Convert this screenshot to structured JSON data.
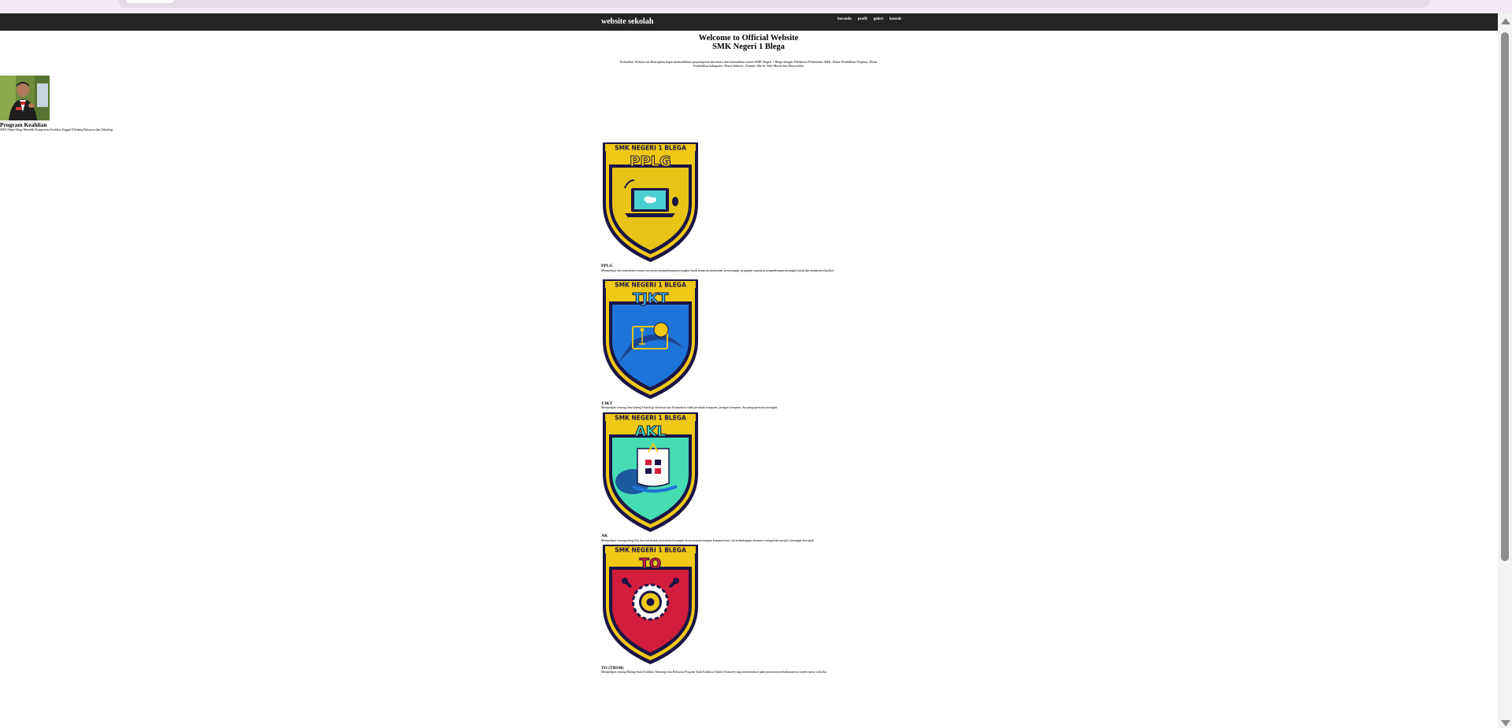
{
  "navbar": {
    "brand": "website sekolah",
    "menu": [
      "beranda",
      "profil",
      "galeri",
      "kontak"
    ]
  },
  "hero": {
    "title_line1": "Welcome to Official Website",
    "title_line2": "SMK Negeri 1 Blega",
    "description": "Kehadiran Website ini diharapkan dapat memudahkan penyampaian informasi dan komunikasi antara SMK Negeri 1 Blega dengan Direktorat Pembinaan SMK, Dinas Pendidikan Propinsi, Dinas Pendidikan kabupaten, Dunia Industri, Alumni, Murid, Wali Murid dan Masyarakat"
  },
  "sidebar": {
    "title": "Program Keahlian",
    "description": "SMK Negeri blega Memiliki Kompetensi Keahlian Unggul Dibidang Rekayasa dan Teknologi"
  },
  "programs": [
    {
      "badge_school": "SMK NEGERI 1 BLEGA",
      "badge_code": "PPLG",
      "name": "PPLG",
      "description": "Mempelajari dan memahami semua cara-proses pengembangan perangkat lunak termasuk pembuatan, perancangan, pengujian organisasi pengembangan perangkat lunak dan manajemen kualitas",
      "colors": {
        "body": "#e8c417",
        "edge": "#f0c816",
        "dark": "#1a1446"
      }
    },
    {
      "badge_school": "SMK NEGERI 1 BLEGA",
      "badge_code": "TJKT",
      "name": "TJKT",
      "description": "Mempelajari tentang ilmu bidang Teknologi informasi dan Komunikasi tiduk perakitan komputer, jaringan komputer, dan pengoperasian perangkat",
      "colors": {
        "body": "#1e74d8",
        "edge": "#f0c816",
        "dark": "#1a1446"
      }
    },
    {
      "badge_school": "SMK NEGERI 1 BLEGA",
      "badge_code": "AKL",
      "name": "AK",
      "description": "Mempelajari tentang mengelola dan melakukan pencatatan keuangan secara manual maupun komputerisasi, etis kelembagaan akuntansi, mengelola transaksi keuangan dan pajak",
      "colors": {
        "body": "#45dcb4",
        "edge": "#f0c816",
        "dark": "#1a1446"
      }
    },
    {
      "badge_school": "SMK NEGERI 1 BLEGA",
      "badge_code": "TO",
      "name": "TO (TBSM)",
      "description": "Mempelajari tentang Bidang Studi Keahlian Teknologi dan Rekayasa Program Studi Keahlian Teknik Otomotif yang memfokuskan pada perawatan perbaikan mesin sepeda motor roda dua",
      "colors": {
        "body": "#d21e3c",
        "edge": "#f0c816",
        "dark": "#1a1446"
      }
    }
  ]
}
